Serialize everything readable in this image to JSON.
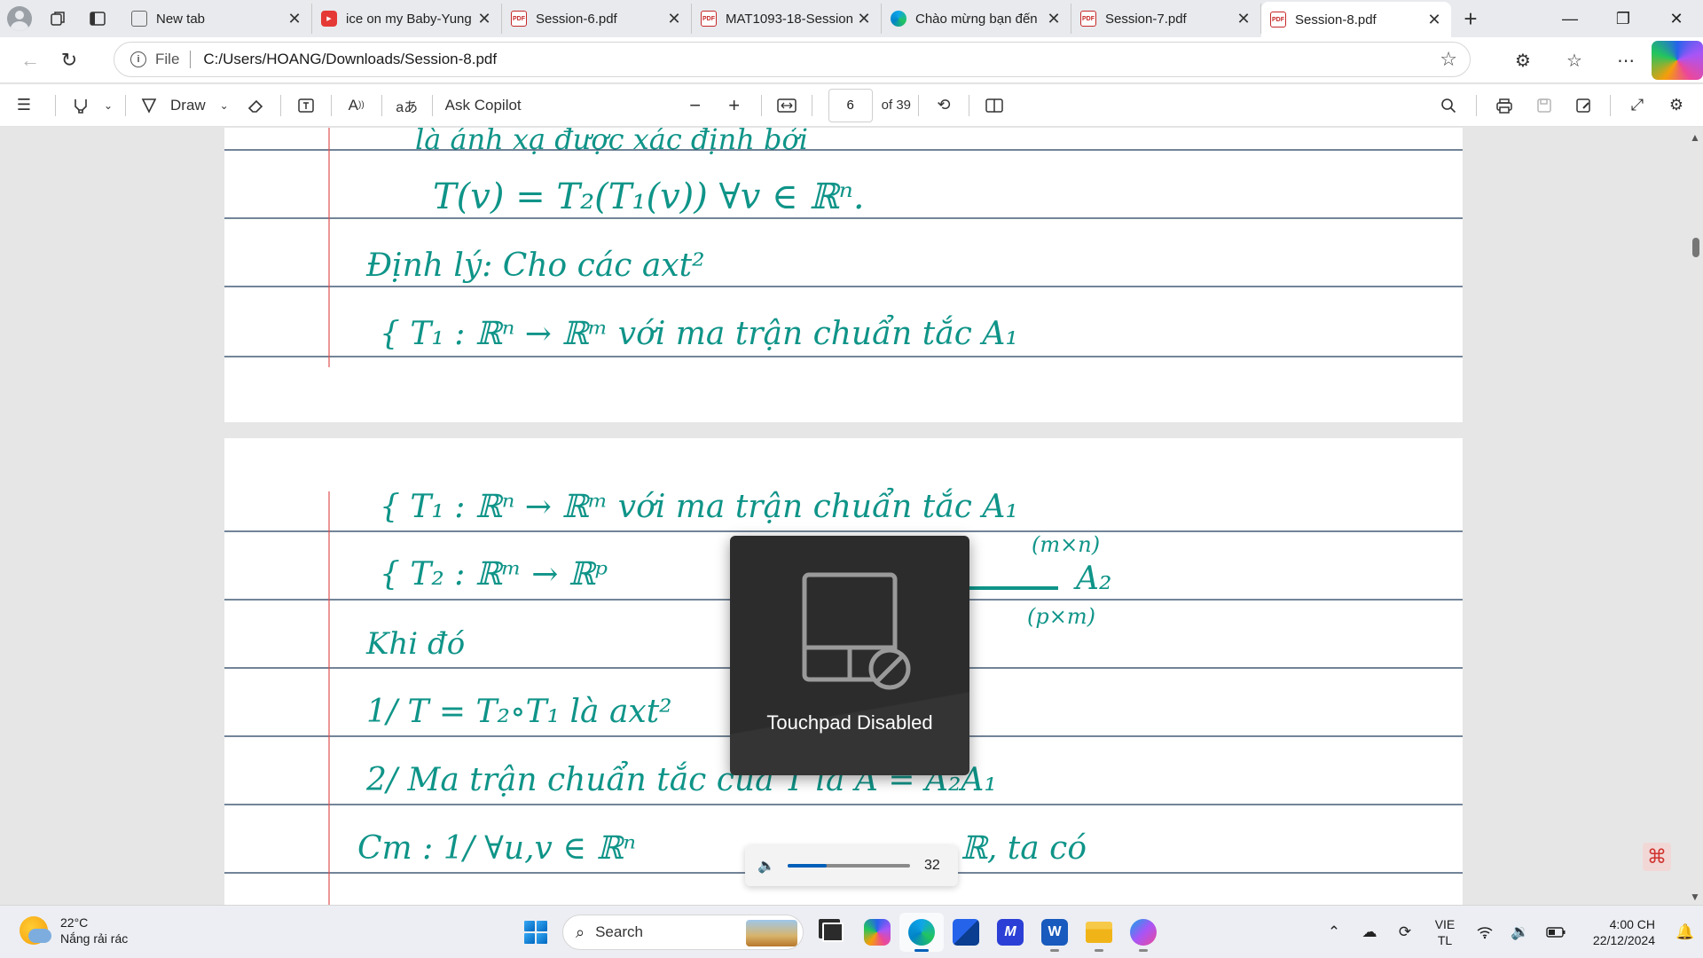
{
  "tabs": [
    {
      "label": "New tab",
      "icon": "newtab"
    },
    {
      "label": "ice on my Baby-Yung",
      "icon": "youtube"
    },
    {
      "label": "Session-6.pdf",
      "icon": "pdf"
    },
    {
      "label": "MAT1093-18-Session",
      "icon": "pdf"
    },
    {
      "label": "Chào mừng bạn đến",
      "icon": "edge"
    },
    {
      "label": "Session-7.pdf",
      "icon": "pdf"
    },
    {
      "label": "Session-8.pdf",
      "icon": "pdf",
      "active": true
    }
  ],
  "address": {
    "scheme": "File",
    "url": "C:/Users/HOANG/Downloads/Session-8.pdf"
  },
  "pdf_toolbar": {
    "draw_label": "Draw",
    "ask_copilot_label": "Ask Copilot",
    "page_number": "6",
    "page_count": "of 39"
  },
  "notes": {
    "page1_lines": [
      "là ánh xạ được xác định bởi",
      "T(v) = T₂(T₁(v))   ∀v ∈ ℝⁿ.",
      "Định lý:  Cho các axt²",
      "{ T₁ : ℝⁿ → ℝᵐ  với ma trận chuẩn tắc A₁"
    ],
    "page2_lines": [
      "{ T₁ : ℝⁿ → ℝᵐ  với ma trận chuẩn tắc A₁",
      "{ T₂ : ℝᵐ → ℝᵖ",
      "(m×n)",
      "A₂",
      "(p×m)",
      "Khi đó",
      "1/ T = T₂∘T₁  là axt²",
      "2/ Ma trận chuẩn tắc của T là A = A₂A₁",
      "Cm :  1/  ∀u,v ∈ ℝⁿ",
      "ℝ, ta có"
    ],
    "ink_color": "#0f9488"
  },
  "overlay": {
    "touchpad_label": "Touchpad Disabled",
    "volume_value": "32",
    "volume_level_percent": 32
  },
  "taskbar": {
    "temperature": "22°C",
    "weather_desc": "Nắng rải rác",
    "search_placeholder": "Search",
    "language_top": "VIE",
    "language_bottom": "TL",
    "time": "4:00 CH",
    "date": "22/12/2024"
  },
  "colors": {
    "accent": "#005fb8",
    "margin_line": "#e05050",
    "ruled_line": "#1f3a5a"
  }
}
